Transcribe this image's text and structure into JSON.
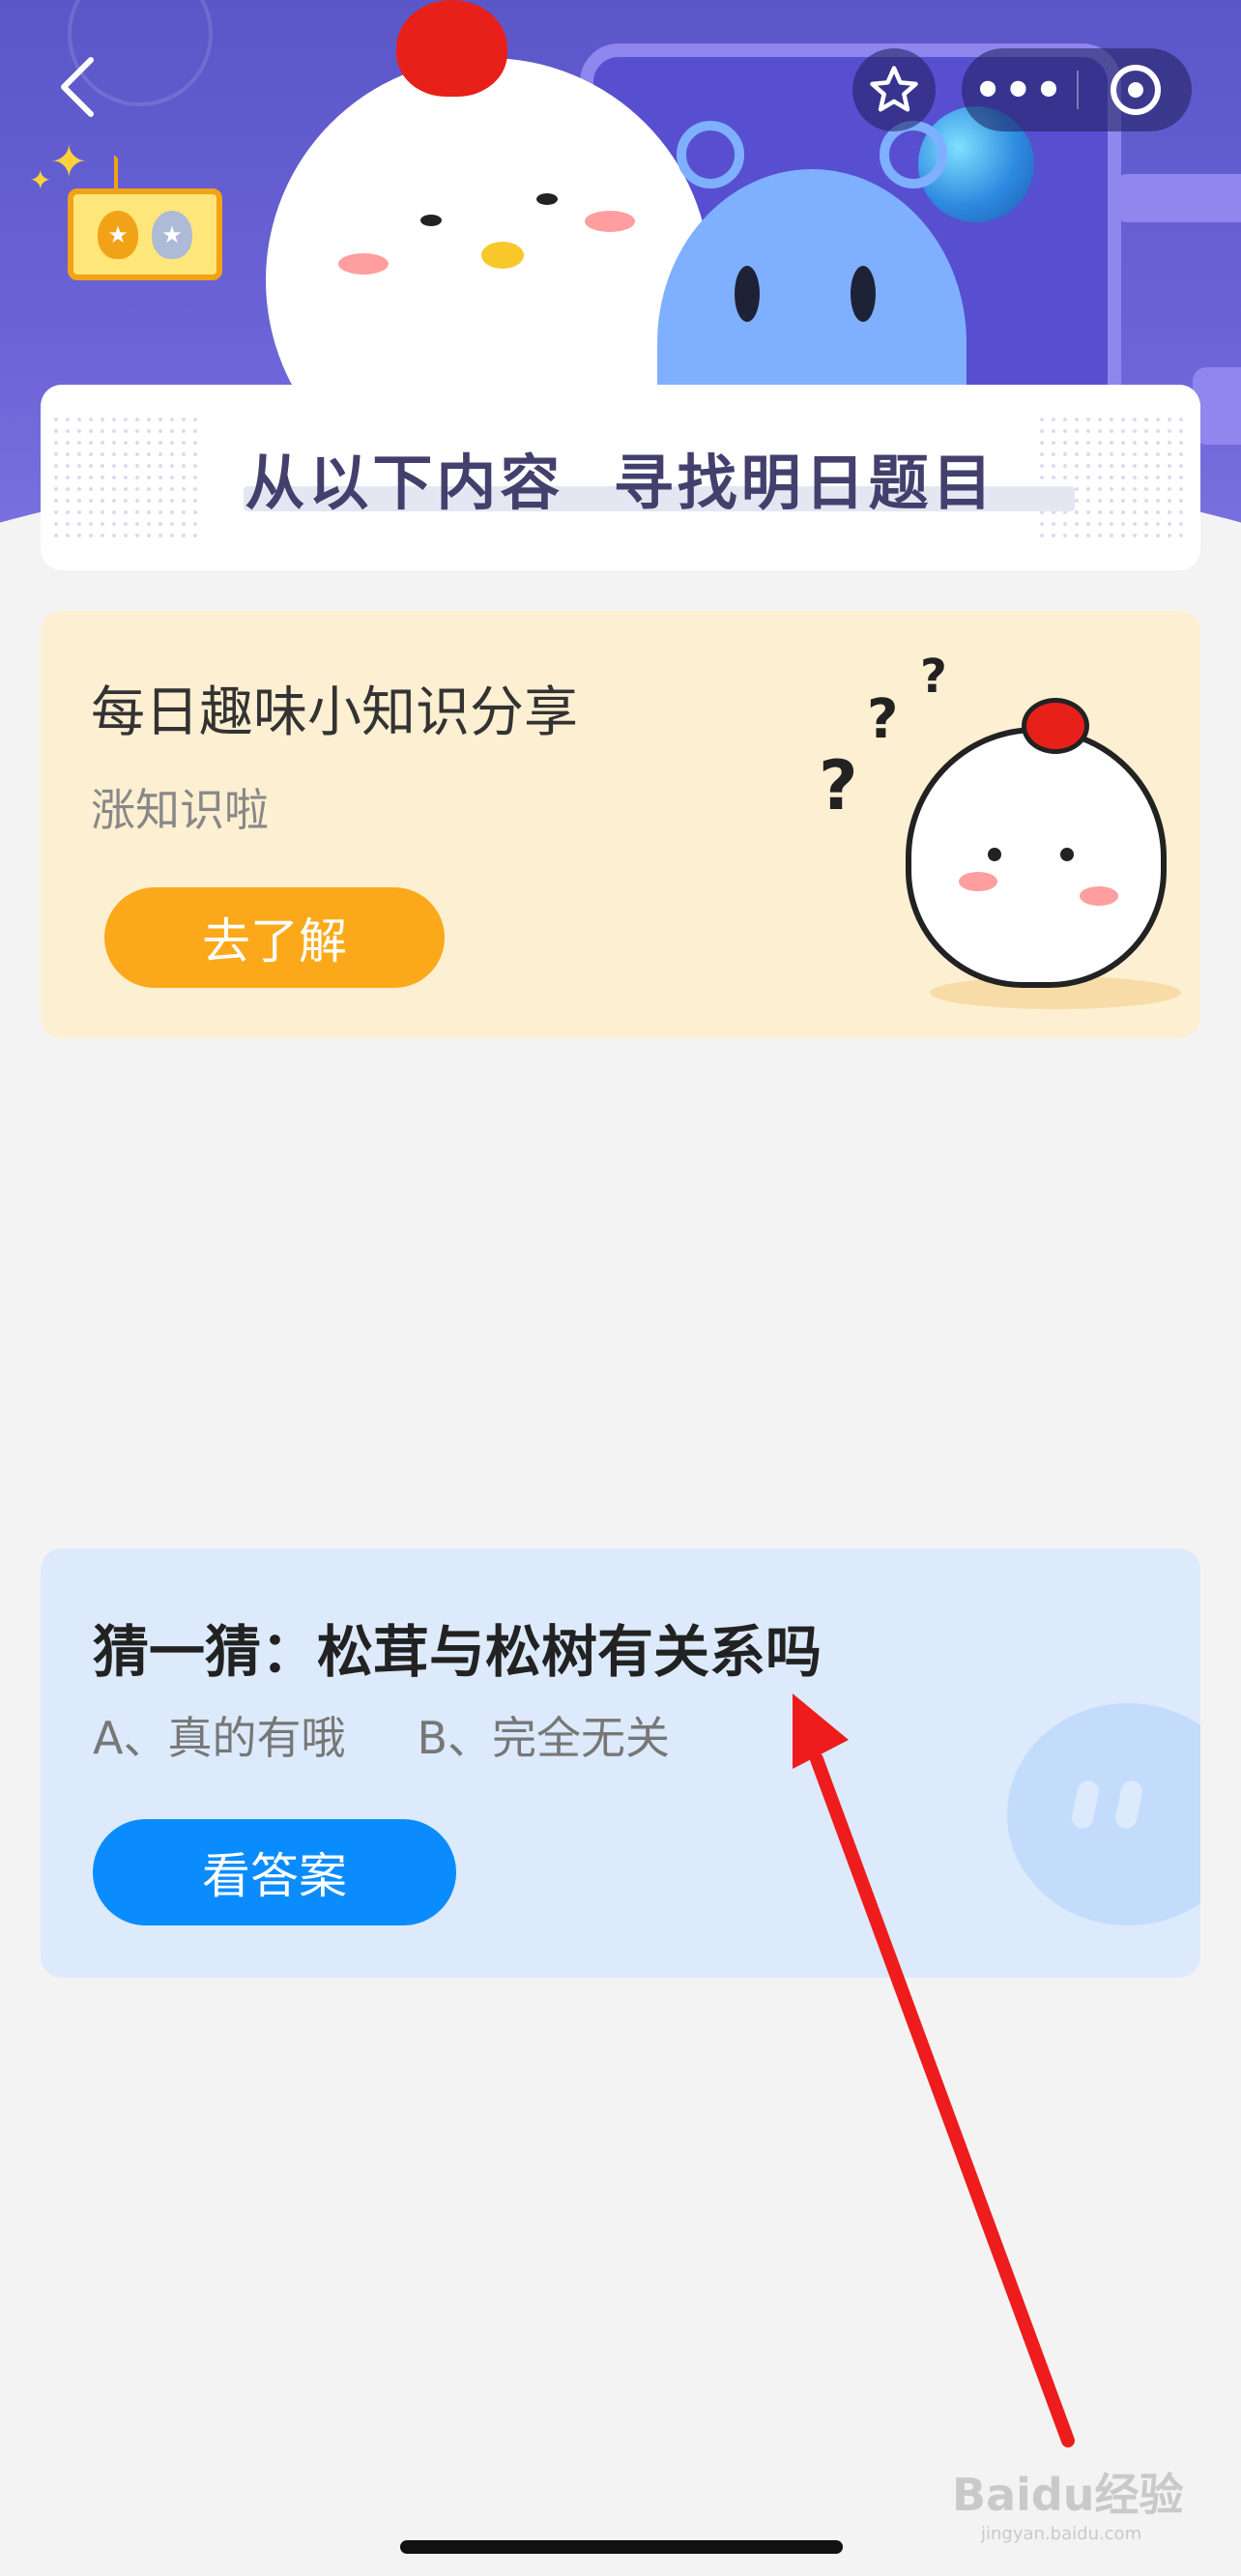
{
  "nav": {
    "back_icon": "chevron-left-icon",
    "favorite_icon": "star-icon",
    "more_icon": "ellipsis-icon",
    "close_icon": "target-icon",
    "more_label": "•••"
  },
  "banner": {
    "title": "从以下内容  寻找明日题目"
  },
  "knowledge_card": {
    "title": "每日趣味小知识分享",
    "subtitle": "涨知识啦",
    "button_label": "去了解",
    "accent": "#fba91a"
  },
  "question_card": {
    "title": "猜一猜：松茸与松树有关系吗",
    "option_a": "A、真的有哦",
    "option_b": "B、完全无关",
    "button_label": "看答案",
    "accent": "#0a8cff"
  },
  "annotation": {
    "arrow_color": "#ee1c1c"
  },
  "watermark": {
    "brand": "Baidu经验",
    "domain": "jingyan.baidu.com"
  }
}
